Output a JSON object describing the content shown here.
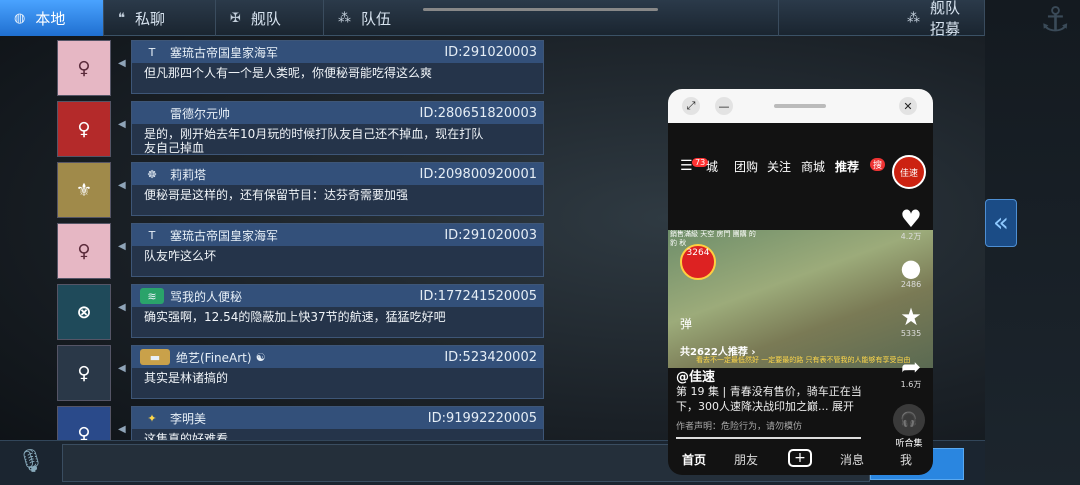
{
  "tabs": [
    {
      "label": "本地",
      "icon": "globe-icon"
    },
    {
      "label": "私聊",
      "icon": "chat-bubbles-icon"
    },
    {
      "label": "舰队",
      "icon": "fleet-emblem-icon"
    },
    {
      "label": "队伍",
      "icon": "team-icon"
    },
    {
      "label": "舰队招募",
      "icon": "recruit-icon"
    }
  ],
  "messages": [
    {
      "name": "塞琉古帝国皇家海军",
      "id": "ID:291020003",
      "text": "但凡那四个人有一个是人类呢，你便秘哥能吃得这么爽",
      "emblem": "T",
      "emblem_bg": "#33507a"
    },
    {
      "name": "雷德尔元帅",
      "id": "ID:280651820003",
      "text": "是的，刚开始去年10月玩的时候打队友自己还不掉血，现在打队友自己掉血",
      "emblem": "",
      "emblem_bg": "#33507a"
    },
    {
      "name": "莉莉塔",
      "id": "ID:209800920001",
      "text": "便秘哥是这样的，还有保留节目：达芬奇需要加强",
      "emblem": "☸",
      "emblem_bg": "#33507a"
    },
    {
      "name": "塞琉古帝国皇家海军",
      "id": "ID:291020003",
      "text": "队友咋这么坏",
      "emblem": "T",
      "emblem_bg": "#33507a"
    },
    {
      "name": "骂我的人便秘",
      "id": "ID:177241520005",
      "text": "确实强啊，12.54的隐蔽加上快37节的航速，猛猛吃好吧",
      "emblem": "≋",
      "emblem_bg": "#2aa36a"
    },
    {
      "name": "绝艺(FineArt)",
      "id": "ID:523420002",
      "text": "其实是林诸搞的",
      "emblem": "▬",
      "emblem_bg": "#c9a14a"
    },
    {
      "name": "李明美",
      "id": "ID:91992220005",
      "text": "这集真的好难看",
      "emblem": "✦",
      "emblem_bg": "#33507a"
    }
  ],
  "phone": {
    "nav": {
      "badge": "73",
      "items": [
        "城",
        "团购",
        "关注",
        "商城",
        "推荐"
      ],
      "hot": "搜"
    },
    "profile_label": "佳速",
    "video": {
      "top_text": "銷售滿級 天空 房門 團購 的 豹 秋",
      "like_badge": "3264",
      "danmaku": "弹",
      "recommend": "共2622人推荐 ›",
      "subtitle": "看去不一定最低然好 一定要最的路 只有表不管我的人能够有享受自由"
    },
    "side": [
      {
        "icon": "heart-icon",
        "glyph": "♥",
        "count": "4.2万"
      },
      {
        "icon": "comment-icon",
        "glyph": "●",
        "count": "2486"
      },
      {
        "icon": "star-icon",
        "glyph": "★",
        "count": "5335"
      },
      {
        "icon": "share-icon",
        "glyph": "➦",
        "count": "1.6万"
      }
    ],
    "author": "@佳速",
    "desc": "第 19 集 | 青春没有售价，骑车正在当下，300人速降决战印加之巅... 展开",
    "notice": "作者声明：危险行为，请勿模仿",
    "listen": "听合集",
    "progress": 1.0,
    "tabs": [
      "首页",
      "朋友",
      "+",
      "消息",
      "我"
    ]
  }
}
